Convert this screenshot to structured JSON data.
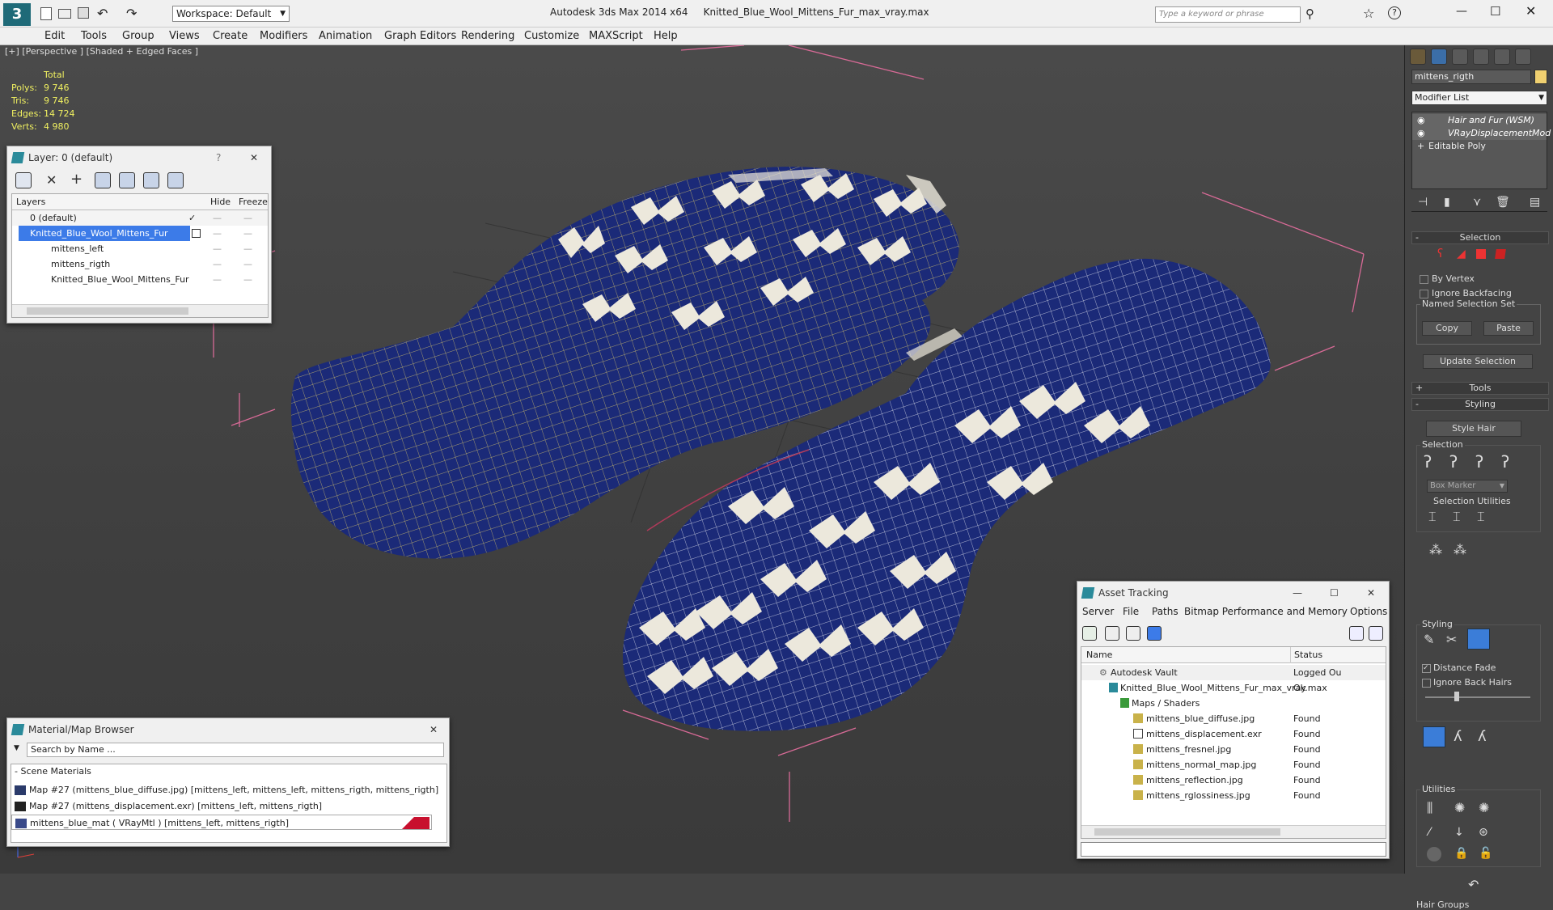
{
  "app": {
    "title": "Autodesk 3ds Max  2014 x64",
    "file": "Knitted_Blue_Wool_Mittens_Fur_max_vray.max",
    "workspace": "Workspace: Default",
    "search_placeholder": "Type a keyword or phrase"
  },
  "menu": [
    "Edit",
    "Tools",
    "Group",
    "Views",
    "Create",
    "Modifiers",
    "Animation",
    "Graph Editors",
    "Rendering",
    "Customize",
    "MAXScript",
    "Help"
  ],
  "viewport": {
    "label": "[+] [Perspective ] [Shaded + Edged Faces ]",
    "stats": {
      "header": "Total",
      "polys_label": "Polys:",
      "polys": "9 746",
      "tris_label": "Tris:",
      "tris": "9 746",
      "edges_label": "Edges:",
      "edges": "14 724",
      "verts_label": "Verts:",
      "verts": "4 980"
    }
  },
  "layer_window": {
    "title": "Layer: 0 (default)",
    "help": "?",
    "columns": [
      "Layers",
      "Hide",
      "Freeze"
    ],
    "rows": [
      "0 (default)",
      "Knitted_Blue_Wool_Mittens_Fur",
      "mittens_left",
      "mittens_rigth",
      "Knitted_Blue_Wool_Mittens_Fur"
    ]
  },
  "material_browser": {
    "title": "Material/Map Browser",
    "search": "Search by Name ...",
    "section": "- Scene Materials",
    "items": [
      "Map #27 (mittens_blue_diffuse.jpg) [mittens_left, mittens_left, mittens_rigth, mittens_rigth]",
      "Map #27 (mittens_displacement.exr)  [mittens_left, mittens_rigth]",
      "mittens_blue_mat  ( VRayMtl ) [mittens_left, mittens_rigth]"
    ]
  },
  "asset_tracking": {
    "title": "Asset Tracking",
    "menu": [
      "Server",
      "File",
      "Paths",
      "Bitmap Performance and Memory",
      "Options"
    ],
    "columns": [
      "Name",
      "Status"
    ],
    "rows": [
      {
        "name": "Autodesk Vault",
        "status": "Logged Ou"
      },
      {
        "name": "Knitted_Blue_Wool_Mittens_Fur_max_vray.max",
        "status": "Ok"
      },
      {
        "name": "Maps / Shaders",
        "status": ""
      },
      {
        "name": "mittens_blue_diffuse.jpg",
        "status": "Found"
      },
      {
        "name": "mittens_displacement.exr",
        "status": "Found"
      },
      {
        "name": "mittens_fresnel.jpg",
        "status": "Found"
      },
      {
        "name": "mittens_normal_map.jpg",
        "status": "Found"
      },
      {
        "name": "mittens_reflection.jpg",
        "status": "Found"
      },
      {
        "name": "mittens_rglossiness.jpg",
        "status": "Found"
      }
    ]
  },
  "command_panel": {
    "object_name": "mittens_rigth",
    "modifier_list": "Modifier List",
    "stack": [
      "Hair and Fur (WSM)",
      "VRayDisplacementMod",
      "Editable Poly"
    ],
    "selection_rollout": "Selection",
    "by_vertex": "By Vertex",
    "ignore_backfacing": "Ignore Backfacing",
    "named_selection_set": "Named Selection Set",
    "copy": "Copy",
    "paste": "Paste",
    "update_selection": "Update Selection",
    "tools_rollout": "Tools",
    "styling_rollout": "Styling",
    "style_hair": "Style Hair",
    "selection_label": "Selection",
    "box_marker": "Box Marker",
    "selection_utilities": "Selection Utilities",
    "styling_label": "Styling",
    "distance_fade": "Distance Fade",
    "ignore_back_hairs": "Ignore Back Hairs",
    "utilities_label": "Utilities",
    "hair_groups": "Hair Groups"
  }
}
